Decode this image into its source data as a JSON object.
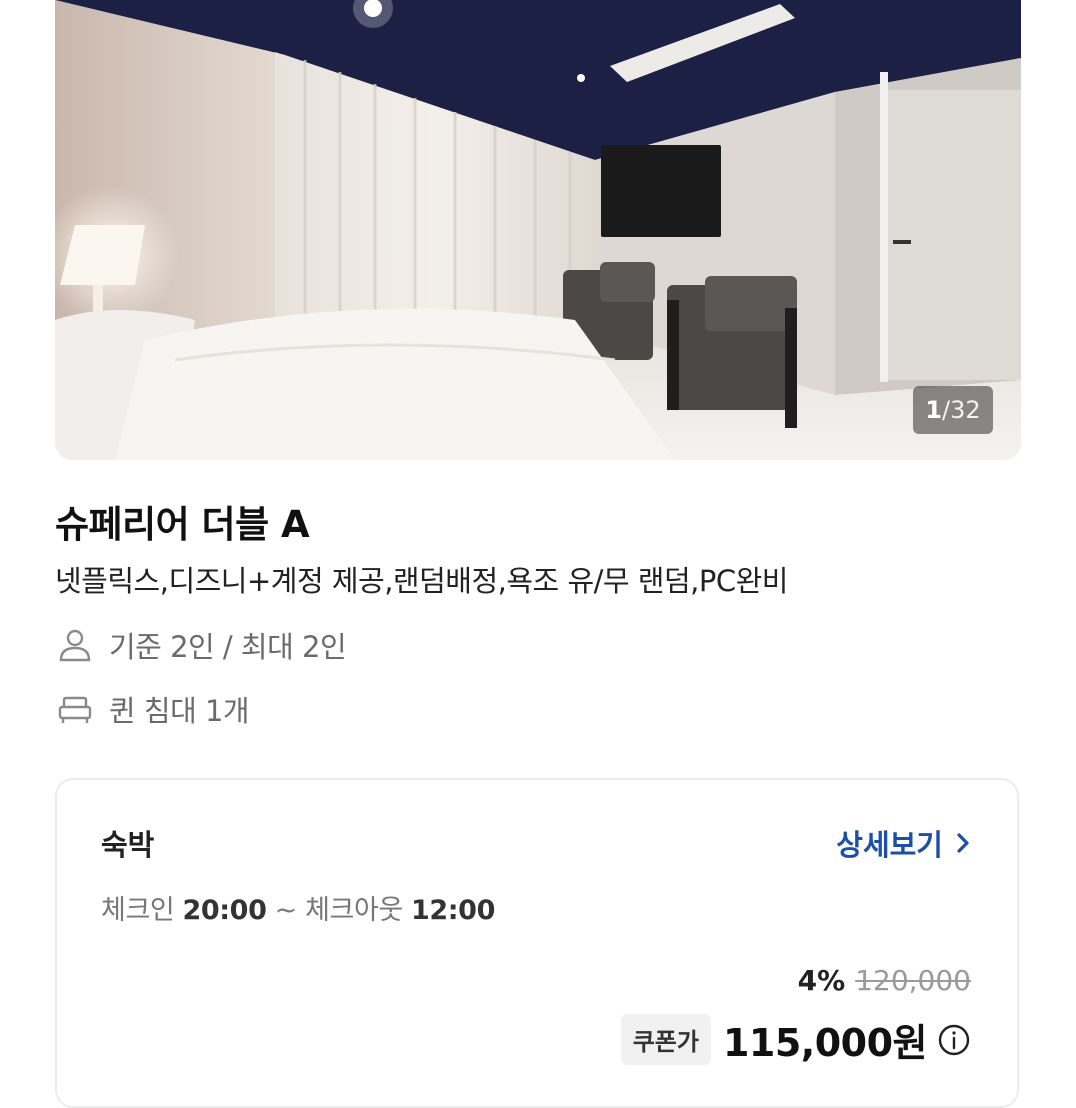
{
  "gallery": {
    "current": "1",
    "total": "/32"
  },
  "room": {
    "title": "슈페리어 더블 A",
    "description": "넷플릭스,디즈니+계정 제공,랜덤배정,욕조 유/무 랜덤,PC완비",
    "guests": "기준 2인 / 최대 2인",
    "bed": "퀸 침대 1개"
  },
  "icons": {
    "guests": "person-icon",
    "bed": "bed-icon",
    "chevron": "chevron-right-icon",
    "info": "info-icon"
  },
  "plan": {
    "type": "숙박",
    "detail_label": "상세보기",
    "checkin_label": "체크인 ",
    "checkin_time": "20:00",
    "separator": " ~ ",
    "checkout_label": "체크아웃 ",
    "checkout_time": "12:00",
    "discount": "4%",
    "original_price": "120,000",
    "coupon_label": "쿠폰가",
    "final_price": "115,000원"
  },
  "colors": {
    "accent": "#1d4fa8",
    "ceiling": "#1c2044"
  }
}
